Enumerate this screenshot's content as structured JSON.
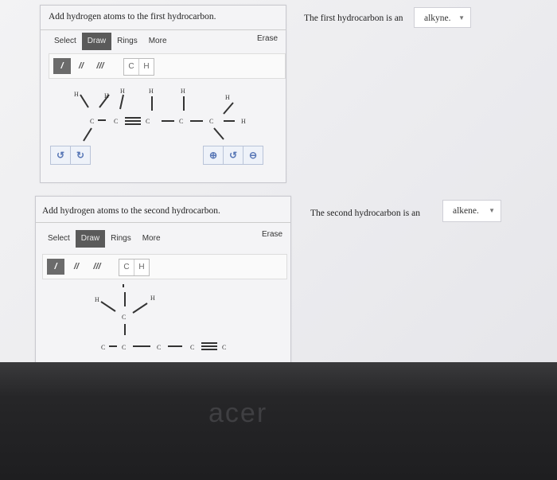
{
  "problem1": {
    "title": "Add hydrogen atoms to the first hydrocarbon.",
    "toolbar": {
      "select": "Select",
      "draw": "Draw",
      "rings": "Rings",
      "more": "More",
      "erase": "Erase"
    },
    "bonds": {
      "single": "/",
      "double": "//",
      "triple": "///"
    },
    "atoms": {
      "c": "C",
      "h": "H"
    },
    "controls": {
      "undo": "↺",
      "redo": "↻",
      "zoom_in": "⊕",
      "reset": "↺",
      "zoom_out": "⊖"
    },
    "question": "The first hydrocarbon is an",
    "answer": "alkyne."
  },
  "problem2": {
    "title": "Add hydrogen atoms to the second hydrocarbon.",
    "toolbar": {
      "select": "Select",
      "draw": "Draw",
      "rings": "Rings",
      "more": "More",
      "erase": "Erase"
    },
    "bonds": {
      "single": "/",
      "double": "//",
      "triple": "///"
    },
    "atoms": {
      "c": "C",
      "h": "H"
    },
    "question": "The second hydrocarbon is an",
    "answer": "alkene."
  },
  "molecule_labels": {
    "h": "H",
    "c": "C"
  },
  "hardware": {
    "brand": "acer"
  }
}
